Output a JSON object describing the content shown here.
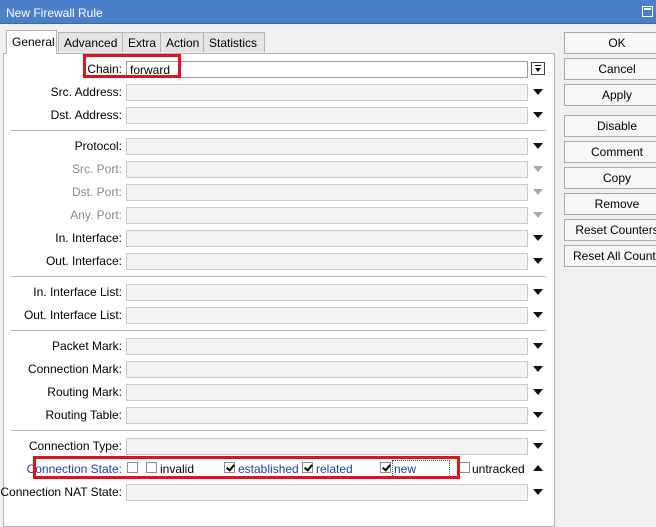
{
  "window": {
    "title": "New Firewall Rule"
  },
  "tabs": [
    {
      "label": "General"
    },
    {
      "label": "Advanced"
    },
    {
      "label": "Extra"
    },
    {
      "label": "Action"
    },
    {
      "label": "Statistics"
    }
  ],
  "fields": {
    "chain": {
      "label": "Chain:",
      "value": "forward"
    },
    "src_address": {
      "label": "Src. Address:"
    },
    "dst_address": {
      "label": "Dst. Address:"
    },
    "protocol": {
      "label": "Protocol:"
    },
    "src_port": {
      "label": "Src. Port:"
    },
    "dst_port": {
      "label": "Dst. Port:"
    },
    "any_port": {
      "label": "Any. Port:"
    },
    "in_interface": {
      "label": "In. Interface:"
    },
    "out_interface": {
      "label": "Out. Interface:"
    },
    "in_interface_list": {
      "label": "In. Interface List:"
    },
    "out_interface_list": {
      "label": "Out. Interface List:"
    },
    "packet_mark": {
      "label": "Packet Mark:"
    },
    "connection_mark": {
      "label": "Connection Mark:"
    },
    "routing_mark": {
      "label": "Routing Mark:"
    },
    "routing_table": {
      "label": "Routing Table:"
    },
    "connection_type": {
      "label": "Connection Type:"
    },
    "connection_nat_state": {
      "label": "Connection NAT State:"
    }
  },
  "connection_state": {
    "label": "Connection State:",
    "options": [
      {
        "label": "invalid",
        "checked": false
      },
      {
        "label": "established",
        "checked": true
      },
      {
        "label": "related",
        "checked": true
      },
      {
        "label": "new",
        "checked": true
      },
      {
        "label": "untracked",
        "checked": false
      }
    ]
  },
  "buttons": {
    "ok": "OK",
    "cancel": "Cancel",
    "apply": "Apply",
    "disable": "Disable",
    "comment": "Comment",
    "copy": "Copy",
    "remove": "Remove",
    "reset_counters": "Reset Counters",
    "reset_all_counters": "Reset All Counters"
  },
  "colors": {
    "titlebar": "#4b7fc9",
    "highlight": "#e0121b",
    "link_text": "#1e3ea8"
  }
}
